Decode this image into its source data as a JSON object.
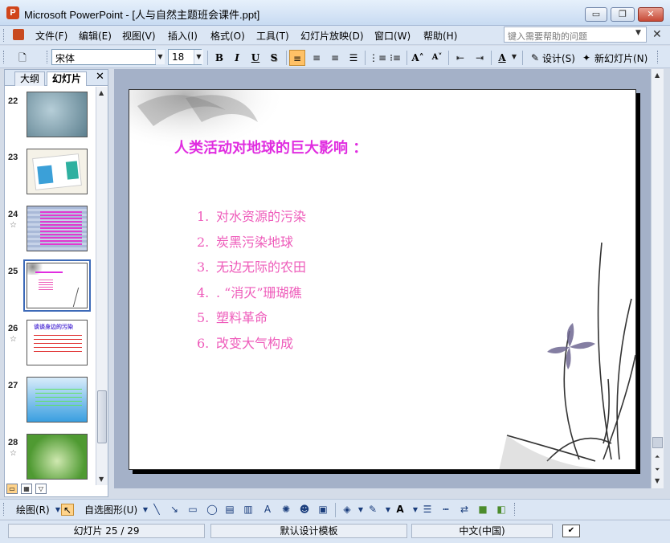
{
  "window": {
    "app_icon": "P",
    "title": "Microsoft PowerPoint - [人与自然主题班会课件.ppt]",
    "minimize": "▭",
    "restore": "❐",
    "close": "✕"
  },
  "menu": {
    "items": [
      "文件(F)",
      "编辑(E)",
      "视图(V)",
      "插入(I)",
      "格式(O)",
      "工具(T)",
      "幻灯片放映(D)",
      "窗口(W)",
      "帮助(H)"
    ],
    "help_placeholder": "键入需要帮助的问题"
  },
  "toolbar": {
    "font_name": "宋体",
    "font_size": "18",
    "bold": "B",
    "italic": "I",
    "underline": "U",
    "shadow": "S",
    "design_label": "设计(S)",
    "new_slide_label": "新幻灯片(N)"
  },
  "left_pane": {
    "tab_outline": "大纲",
    "tab_slides": "幻灯片",
    "close": "✕",
    "thumbnails": [
      {
        "number": "22",
        "has_animation": false
      },
      {
        "number": "23",
        "has_animation": false
      },
      {
        "number": "24",
        "has_animation": true
      },
      {
        "number": "25",
        "has_animation": false,
        "selected": true
      },
      {
        "number": "26",
        "has_animation": true,
        "caption": "谈谈身边的污染"
      },
      {
        "number": "27",
        "has_animation": false
      },
      {
        "number": "28",
        "has_animation": true
      }
    ],
    "star_glyph": "☆"
  },
  "slide": {
    "title": "人类活动对地球的巨大影响 ：",
    "items": [
      {
        "num": "1.",
        "text": "对水资源的污染"
      },
      {
        "num": "2.",
        "text": "炭黑污染地球"
      },
      {
        "num": "3.",
        "text": "无边无际的农田"
      },
      {
        "num": "4.",
        "text": ". “消灭”珊瑚礁"
      },
      {
        "num": "5.",
        "text": "塑料革命"
      },
      {
        "num": "6.",
        "text": "改变大气构成"
      }
    ]
  },
  "draw_toolbar": {
    "draw_label": "绘图(R)",
    "autoshapes_label": "自选图形(U)"
  },
  "status": {
    "slide_position": "幻灯片 25 / 29",
    "template": "默认设计模板",
    "language": "中文(中国)"
  },
  "colors": {
    "slide_title": "#e02de0",
    "slide_list": "#ee5bba",
    "selection_outline": "#3d6ab8"
  }
}
